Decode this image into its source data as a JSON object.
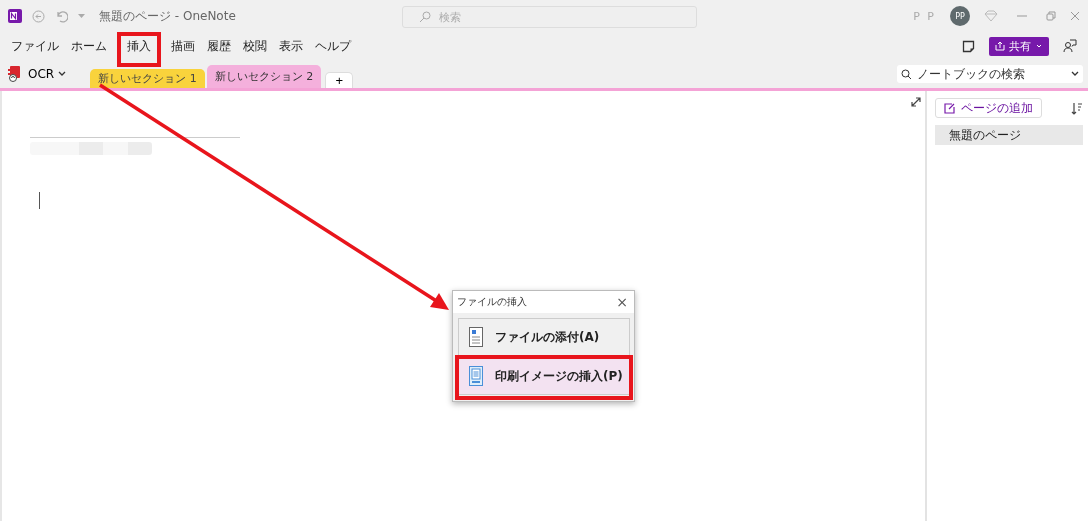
{
  "title_bar": {
    "title": "無題のページ - OneNote",
    "search": {
      "placeholder": "検索"
    },
    "user_initials": "P P",
    "avatar": "PP"
  },
  "menu": [
    {
      "label": "ファイル",
      "annotated": false
    },
    {
      "label": "ホーム",
      "annotated": false
    },
    {
      "label": "挿入",
      "annotated": true
    },
    {
      "label": "描画",
      "annotated": false
    },
    {
      "label": "履歴",
      "annotated": false
    },
    {
      "label": "校閲",
      "annotated": false
    },
    {
      "label": "表示",
      "annotated": false
    },
    {
      "label": "ヘルプ",
      "annotated": false
    }
  ],
  "share_button": "共有",
  "notebook": {
    "name": "OCR"
  },
  "sections": [
    {
      "label": "新しいセクション 1",
      "color": "#f9d33c",
      "selected": false
    },
    {
      "label": "新しいセクション 2",
      "color": "#f4b0dc",
      "selected": true
    }
  ],
  "add_section": "+",
  "notebook_search": {
    "placeholder": "ノートブックの検索"
  },
  "pages_pane": {
    "add_page": "ページの追加",
    "pages": [
      {
        "title": "無題のページ",
        "selected": true
      }
    ]
  },
  "dialog": {
    "title": "ファイルの挿入",
    "close": "×",
    "options": [
      {
        "text": "ファイルの添付(A)",
        "annotated": false,
        "hover": false
      },
      {
        "text": "印刷イメージの挿入(P)",
        "annotated": true,
        "hover": true
      }
    ]
  }
}
